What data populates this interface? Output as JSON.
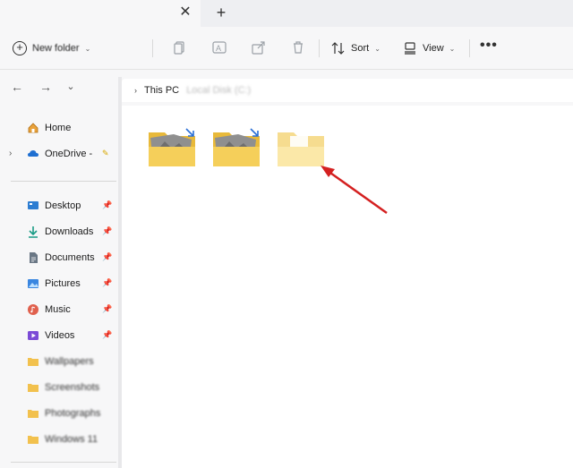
{
  "tab": {
    "close_icon": "close-icon",
    "new_tab_icon": "plus-icon"
  },
  "command_bar": {
    "new_label": "New folder",
    "sort_label": "Sort",
    "view_label": "View",
    "more_label": "•••",
    "icons": [
      "cut-icon",
      "copy-icon",
      "rename-icon",
      "share-icon",
      "delete-icon"
    ]
  },
  "navigation": {
    "back_icon": "arrow-left-icon",
    "forward_icon": "arrow-right-icon",
    "recent_icon": "chevron-down-icon"
  },
  "address": {
    "chevron": "›",
    "crumb": "This PC",
    "blurred": "Local Disk (C:)"
  },
  "sidebar": {
    "home": "Home",
    "onedrive": "OneDrive -",
    "quick_access": [
      {
        "label": "Desktop",
        "icon": "desktop-icon",
        "color": "#2d7dd2"
      },
      {
        "label": "Downloads",
        "icon": "download-icon",
        "color": "#1a9c86"
      },
      {
        "label": "Documents",
        "icon": "document-icon",
        "color": "#5e6b7a"
      },
      {
        "label": "Pictures",
        "icon": "pictures-icon",
        "color": "#3a86e0"
      },
      {
        "label": "Music",
        "icon": "music-icon",
        "color": "#d9534f"
      },
      {
        "label": "Videos",
        "icon": "video-icon",
        "color": "#7b4bd6"
      }
    ],
    "folders": [
      {
        "label": "Wallpapers"
      },
      {
        "label": "Screenshots"
      },
      {
        "label": "Photographs"
      },
      {
        "label": "Windows 11"
      }
    ]
  },
  "content": {
    "folders": [
      {
        "type": "folder-with-images-compressed"
      },
      {
        "type": "folder-with-images-compressed"
      },
      {
        "type": "empty-folder-new"
      }
    ],
    "annotation": "red-arrow-pointing-to-new-folder"
  }
}
